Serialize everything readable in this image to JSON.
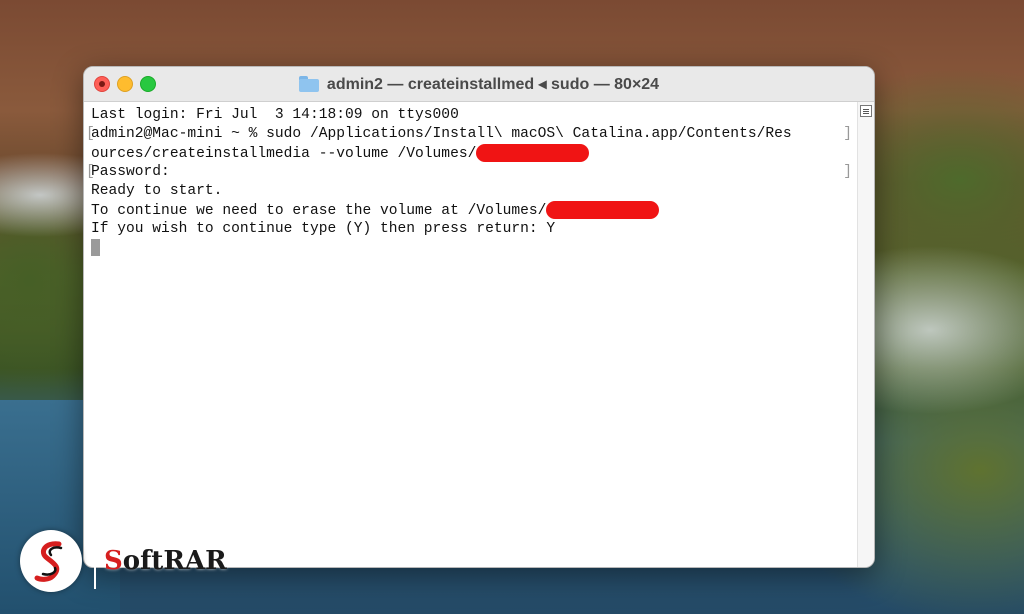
{
  "window": {
    "title": "admin2 — createinstallmed ◂ sudo — 80×24",
    "icon": "folder-icon"
  },
  "terminal": {
    "lines": [
      "Last login: Fri Jul  3 14:18:09 on ttys000",
      "admin2@Mac-mini ~ % sudo /Applications/Install\\ macOS\\ Catalina.app/Contents/Res",
      "ources/createinstallmedia --volume /Volumes/",
      "Password:",
      "Ready to start.",
      "To continue we need to erase the volume at /Volumes/",
      "If you wish to continue type (Y) then press return: Y"
    ],
    "redaction_color": "#f01414"
  },
  "watermark": {
    "brand_first": "S",
    "brand_rest": "oftRAR"
  },
  "colors": {
    "close": "#fe5f57",
    "minimize": "#febc2e",
    "maximize": "#28c840"
  }
}
